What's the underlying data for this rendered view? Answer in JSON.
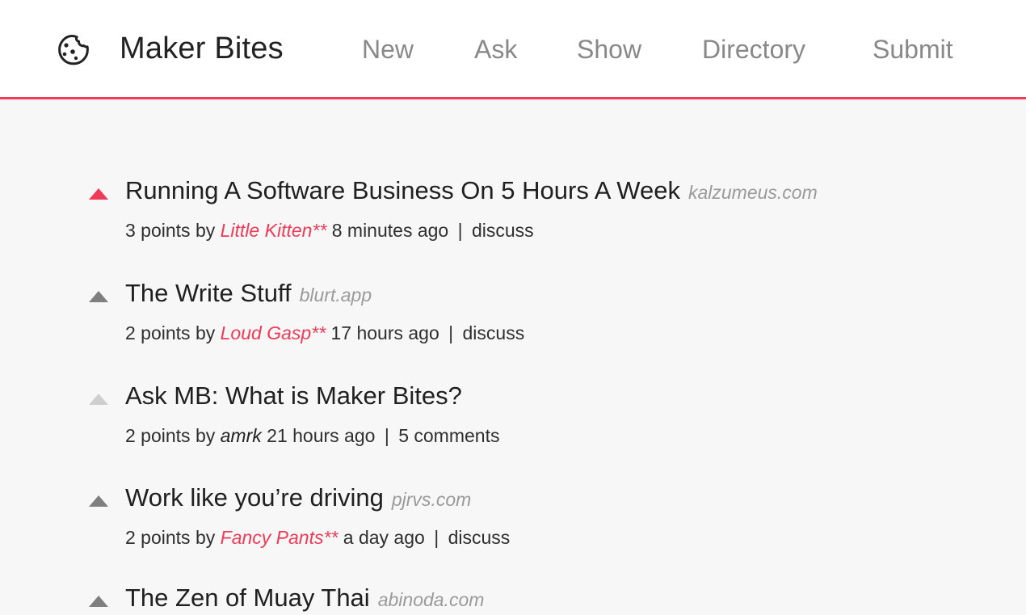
{
  "header": {
    "brand": "Maker Bites",
    "nav": [
      {
        "label": "New"
      },
      {
        "label": "Ask"
      },
      {
        "label": "Show"
      },
      {
        "label": "Directory"
      },
      {
        "label": "Submit"
      }
    ]
  },
  "colors": {
    "accent": "#ef3b57",
    "vote_active": "#ef3b57",
    "vote_default": "#7f7f7f",
    "vote_light": "#cfcfcf"
  },
  "stories": [
    {
      "title": "Running A Software Business On 5 Hours A Week",
      "domain": "kalzumeus.com",
      "points_text": "3 points by",
      "author": "Little Kitten**",
      "age": "8 minutes ago",
      "separator": "|",
      "action": "discuss",
      "vote_state": "active",
      "author_style": "red"
    },
    {
      "title": "The Write Stuff",
      "domain": "blurt.app",
      "points_text": "2 points by",
      "author": "Loud Gasp**",
      "age": "17 hours ago",
      "separator": "|",
      "action": "discuss",
      "vote_state": "default",
      "author_style": "red"
    },
    {
      "title": "Ask MB: What is Maker Bites?",
      "domain": "",
      "points_text": "2 points by",
      "author": "amrk",
      "age": "21 hours ago",
      "separator": "|",
      "action": "5 comments",
      "vote_state": "light",
      "author_style": "plain"
    },
    {
      "title": "Work like you’re driving",
      "domain": "pjrvs.com",
      "points_text": "2 points by",
      "author": "Fancy Pants**",
      "age": "a day ago",
      "separator": "|",
      "action": "discuss",
      "vote_state": "default",
      "author_style": "red"
    },
    {
      "title": "The Zen of Muay Thai",
      "domain": "abinoda.com",
      "points_text": "",
      "author": "",
      "age": "",
      "separator": "",
      "action": "",
      "vote_state": "default",
      "author_style": "red"
    }
  ],
  "icons": {
    "logo": "cookie-icon",
    "vote": "upvote-triangle-icon"
  }
}
